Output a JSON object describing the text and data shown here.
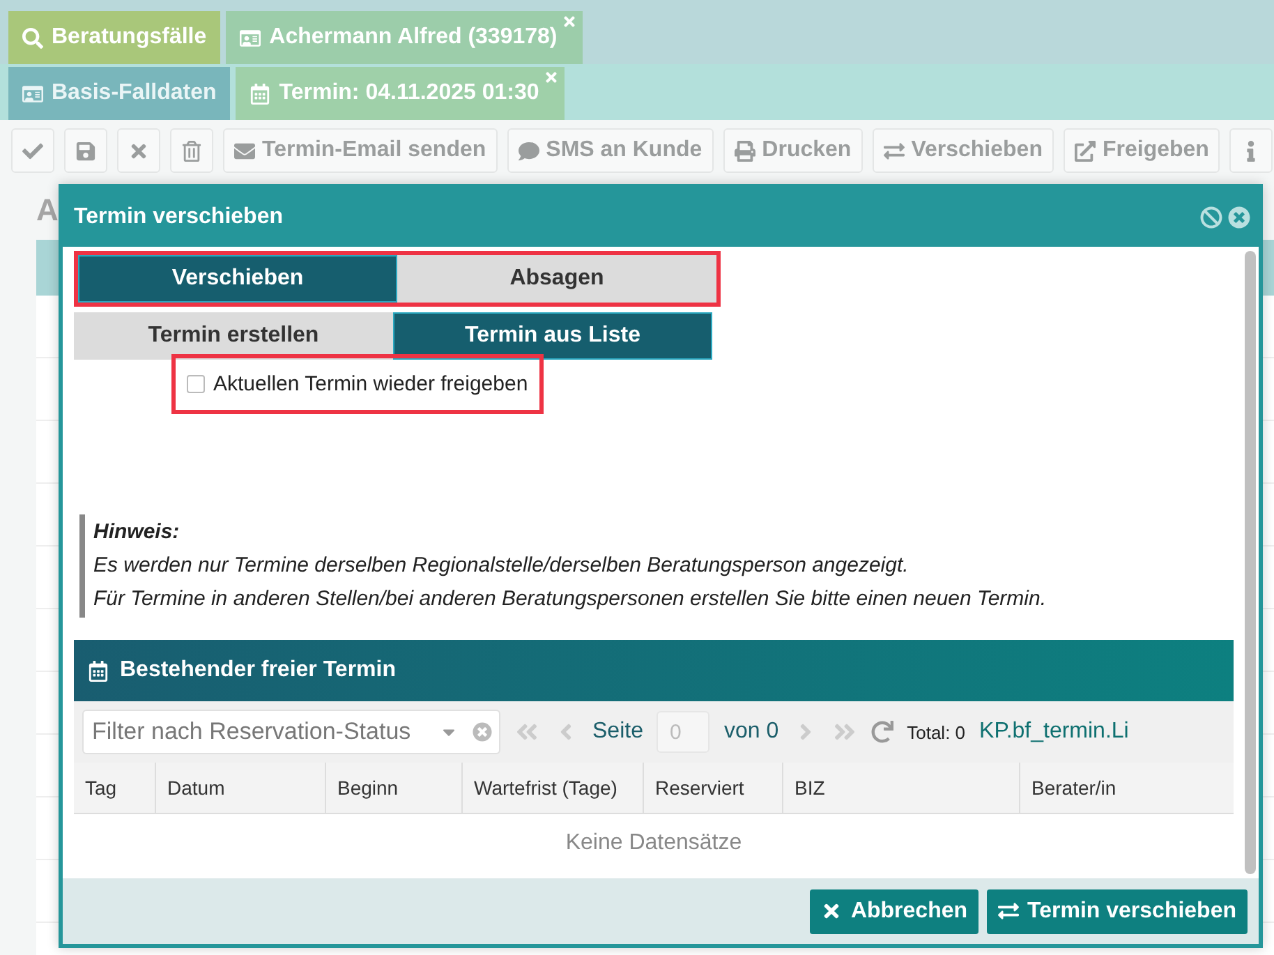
{
  "main_tabs": [
    {
      "label": "Beratungsfälle",
      "selected": false,
      "closable": false
    },
    {
      "label": "Achermann Alfred (339178)",
      "selected": true,
      "closable": true
    }
  ],
  "sub_tabs": [
    {
      "label": "Basis-Falldaten",
      "selected": false,
      "closable": false
    },
    {
      "label": "Termin: 04.11.2025 01:30",
      "selected": true,
      "closable": true
    }
  ],
  "toolbar": [
    {
      "kind": "icon"
    },
    {
      "kind": "icon"
    },
    {
      "kind": "icon"
    },
    {
      "kind": "icon"
    },
    {
      "kind": "text",
      "label": "Termin-Email senden"
    },
    {
      "kind": "text",
      "label": "SMS an Kunde"
    },
    {
      "kind": "text",
      "label": "Drucken"
    },
    {
      "kind": "text",
      "label": "Verschieben"
    },
    {
      "kind": "text",
      "label": "Freigeben"
    },
    {
      "kind": "icon"
    }
  ],
  "page": {
    "heading": "A"
  },
  "dialog": {
    "title": "Termin verschieben",
    "mode_tabs": [
      {
        "label": "Verschieben",
        "selected": true
      },
      {
        "label": "Absagen",
        "selected": false
      }
    ],
    "source_tabs": [
      {
        "label": "Termin erstellen",
        "selected": false
      },
      {
        "label": "Termin aus Liste",
        "selected": true
      }
    ],
    "release_checkbox": {
      "label": "Aktuellen Termin wieder freigeben",
      "checked": false
    },
    "hint": {
      "title": "Hinweis:",
      "lines": [
        "Es werden nur Termine derselben Regionalstelle/derselben Beratungsperson angezeigt.",
        "Für Termine in anderen Stellen/bei anderen Beratungspersonen erstellen Sie bitte einen neuen Termin."
      ]
    },
    "panel": {
      "title": "Bestehender freier Termin",
      "filter": {
        "placeholder": "Filter nach Reservation-Status"
      },
      "pager": {
        "page_label": "Seite",
        "page_value": "0",
        "of_label": "von 0",
        "total": "Total: 0",
        "link": "KP.bf_termin.Li"
      },
      "columns": [
        "Tag",
        "Datum",
        "Beginn",
        "Wartefrist (Tage)",
        "Reserviert",
        "BIZ",
        "Berater/in"
      ],
      "empty_text": "Keine Datensätze"
    },
    "buttons": [
      {
        "label": "Abbrechen"
      },
      {
        "label": "Termin verschieben"
      }
    ]
  }
}
